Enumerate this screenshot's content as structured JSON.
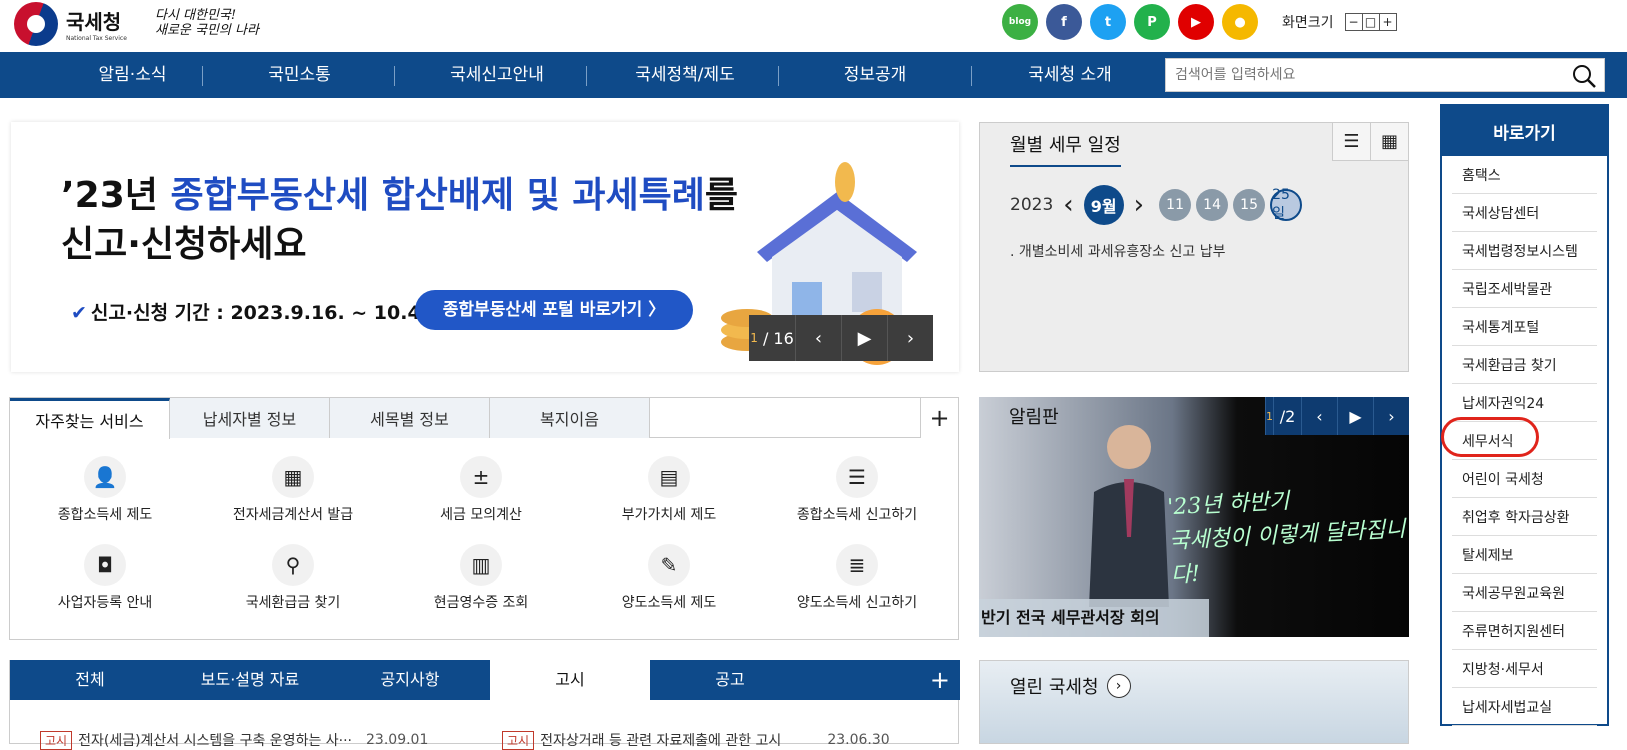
{
  "header": {
    "logo_title": "국세청",
    "logo_sub": "National Tax Service",
    "slogan_line1": "다시 대한민국!",
    "slogan_line2": "새로운 국민의 나라",
    "sns": [
      {
        "name": "blog-icon",
        "label": "blog",
        "color": "#3cb043"
      },
      {
        "name": "facebook-icon",
        "label": "f",
        "color": "#3b5998"
      },
      {
        "name": "twitter-icon",
        "label": "t",
        "color": "#1da1f2"
      },
      {
        "name": "post-icon",
        "label": "P",
        "color": "#22b14c"
      },
      {
        "name": "youtube-icon",
        "label": "▶",
        "color": "#e00000"
      },
      {
        "name": "kakao-icon",
        "label": "●",
        "color": "#f5b800"
      }
    ],
    "font_size_label": "화면크기",
    "font_minus": "−",
    "font_reset": "□",
    "font_plus": "+"
  },
  "nav": {
    "items": [
      "알림·소식",
      "국민소통",
      "국세신고안내",
      "국세정책/제도",
      "정보공개",
      "국세청 소개"
    ],
    "search_placeholder": "검색어를 입력하세요"
  },
  "banner": {
    "line1_prefix": "’23년 ",
    "line1_blue": "종합부동산세 합산배제 및 과세특례",
    "line1_suffix": "를",
    "line2": "신고·신청하세요",
    "period": "신고·신청 기간 : 2023.9.16. ~ 10.4.",
    "button": "종합부동산세 포털 바로가기 〉",
    "page_current": "1",
    "page_total": "16"
  },
  "schedule": {
    "title": "월별 세무 일정",
    "year": "2023",
    "month": "9월",
    "days": [
      "11",
      "14",
      "15",
      "25일"
    ],
    "item": ". 개별소비세 과세유흥장소 신고 납부"
  },
  "services": {
    "tabs": [
      "자주찾는 서비스",
      "납세자별 정보",
      "세목별 정보",
      "복지이음"
    ],
    "plus": "+",
    "items": [
      {
        "label": "종합소득세 제도",
        "icon": "person-icon",
        "glyph": "👤"
      },
      {
        "label": "전자세금계산서 발급",
        "icon": "calculator-icon",
        "glyph": "▦"
      },
      {
        "label": "세금 모의계산",
        "icon": "calc-sign-icon",
        "glyph": "±"
      },
      {
        "label": "부가가치세 제도",
        "icon": "book-icon",
        "glyph": "▤"
      },
      {
        "label": "종합소득세 신고하기",
        "icon": "document-icon",
        "glyph": "☰"
      },
      {
        "label": "사업자등록 안내",
        "icon": "badge-icon",
        "glyph": "◘"
      },
      {
        "label": "국세환급금 찾기",
        "icon": "magnifier-icon",
        "glyph": "⚲"
      },
      {
        "label": "현금영수증 조회",
        "icon": "receipt-icon",
        "glyph": "▥"
      },
      {
        "label": "양도소득세 제도",
        "icon": "pen-doc-icon",
        "glyph": "✎"
      },
      {
        "label": "양도소득세 신고하기",
        "icon": "form-icon",
        "glyph": "≣"
      }
    ]
  },
  "notice": {
    "tabs": [
      "전체",
      "보도·설명 자료",
      "공지사항",
      "고시",
      "공고"
    ],
    "plus": "+",
    "rows": [
      {
        "tag": "고시",
        "title": "전자(세금)계산서 시스템을 구축 운영하는 사···",
        "date": "23.09.01"
      },
      {
        "tag": "고시",
        "title": "전자상거래 등 관련 자료제출에 관한 고시",
        "date": "23.06.30"
      }
    ]
  },
  "board": {
    "title": "알림판",
    "page_current": "1",
    "page_total": "/2",
    "text_line1": "'23년 하반기",
    "text_line2": "국세청이 이렇게 달라집니다!",
    "caption": "반기 전국 세무관서장 회의"
  },
  "open": {
    "title": "열린 국세청"
  },
  "quick": {
    "title": "바로가기",
    "items": [
      "홈택스",
      "국세상담센터",
      "국세법령정보시스템",
      "국립조세박물관",
      "국세통계포털",
      "국세환급금 찾기",
      "납세자권익24",
      "세무서식",
      "어린이 국세청",
      "취업후 학자금상환",
      "탈세제보",
      "국세공무원교육원",
      "주류면허지원센터",
      "지방청·세무서",
      "납세자세법교실"
    ]
  }
}
